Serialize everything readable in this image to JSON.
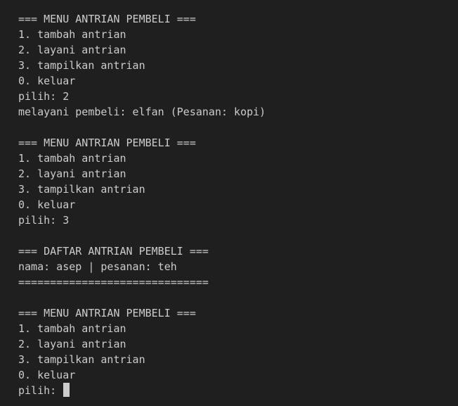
{
  "terminal": {
    "lines": [
      "=== MENU ANTRIAN PEMBELI ===",
      "1. tambah antrian",
      "2. layani antrian",
      "3. tampilkan antrian",
      "0. keluar",
      "pilih: 2",
      "melayani pembeli: elfan (Pesanan: kopi)",
      "",
      "=== MENU ANTRIAN PEMBELI ===",
      "1. tambah antrian",
      "2. layani antrian",
      "3. tampilkan antrian",
      "0. keluar",
      "pilih: 3",
      "",
      "=== DAFTAR ANTRIAN PEMBELI ===",
      "nama: asep | pesanan: teh",
      "==============================",
      "",
      "=== MENU ANTRIAN PEMBELI ===",
      "1. tambah antrian",
      "2. layani antrian",
      "3. tampilkan antrian",
      "0. keluar"
    ],
    "prompt": "pilih: ",
    "colors": {
      "background": "#1f1f1f",
      "text": "#cccccc",
      "cursor": "#cccccc"
    }
  }
}
